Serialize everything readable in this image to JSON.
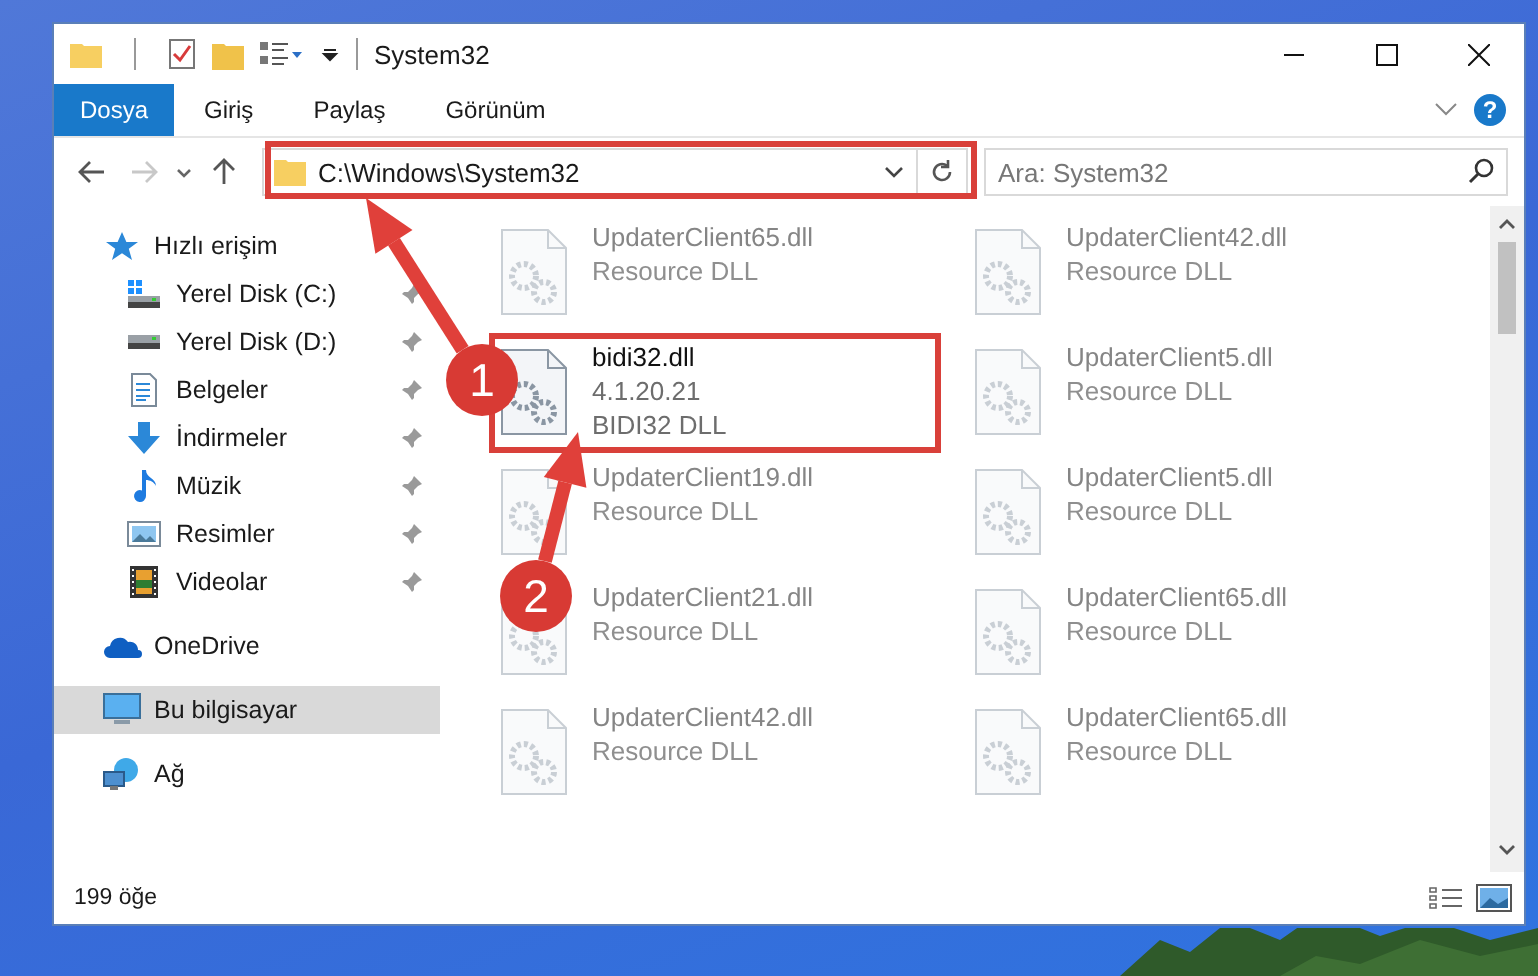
{
  "window": {
    "title": "System32"
  },
  "ribbon_tabs": [
    {
      "label": "Dosya",
      "selected": true
    },
    {
      "label": "Giriş",
      "selected": false
    },
    {
      "label": "Paylaş",
      "selected": false
    },
    {
      "label": "Görünüm",
      "selected": false
    }
  ],
  "ribbon": {
    "help_glyph": "?"
  },
  "address": {
    "path": "C:\\Windows\\System32"
  },
  "search": {
    "placeholder": "Ara: System32"
  },
  "sidebar": {
    "items": [
      {
        "label": "Hızlı erişim",
        "kind": "quick",
        "selected": false,
        "children": [
          {
            "label": "Yerel Disk (C:)",
            "kind": "drive-c",
            "pinned": true,
            "selected": false
          },
          {
            "label": "Yerel Disk (D:)",
            "kind": "drive",
            "pinned": true,
            "selected": false
          },
          {
            "label": "Belgeler",
            "kind": "documents",
            "pinned": true,
            "selected": false
          },
          {
            "label": "İndirmeler",
            "kind": "downloads",
            "pinned": true,
            "selected": false
          },
          {
            "label": "Müzik",
            "kind": "music",
            "pinned": true,
            "selected": false
          },
          {
            "label": "Resimler",
            "kind": "pictures",
            "pinned": true,
            "selected": false
          },
          {
            "label": "Videolar",
            "kind": "videos",
            "pinned": true,
            "selected": false
          }
        ]
      },
      {
        "label": "OneDrive",
        "kind": "cloud",
        "selected": false
      },
      {
        "label": "Bu bilgisayar",
        "kind": "pc",
        "selected": true
      },
      {
        "label": "Ağ",
        "kind": "network",
        "selected": false
      }
    ]
  },
  "files": [
    {
      "name": "UpdaterClient65.dll",
      "details": [
        "Resource DLL"
      ],
      "faded": true
    },
    {
      "name": "UpdaterClient42.dll",
      "details": [
        "Resource DLL"
      ],
      "faded": true
    },
    {
      "name": "bidi32.dll",
      "details": [
        "4.1.20.21",
        "BIDI32 DLL"
      ],
      "faded": false
    },
    {
      "name": "UpdaterClient5.dll",
      "details": [
        "Resource DLL"
      ],
      "faded": true
    },
    {
      "name": "UpdaterClient19.dll",
      "details": [
        "Resource DLL"
      ],
      "faded": true
    },
    {
      "name": "UpdaterClient5.dll",
      "details": [
        "Resource DLL"
      ],
      "faded": true
    },
    {
      "name": "UpdaterClient21.dll",
      "details": [
        "Resource DLL"
      ],
      "faded": true
    },
    {
      "name": "UpdaterClient65.dll",
      "details": [
        "Resource DLL"
      ],
      "faded": true
    },
    {
      "name": "UpdaterClient42.dll",
      "details": [
        "Resource DLL"
      ],
      "faded": true
    },
    {
      "name": "UpdaterClient65.dll",
      "details": [
        "Resource DLL"
      ],
      "faded": true
    }
  ],
  "status_bar": {
    "count": "199 öğe"
  },
  "annotations": [
    {
      "label": "1"
    },
    {
      "label": "2"
    }
  ]
}
